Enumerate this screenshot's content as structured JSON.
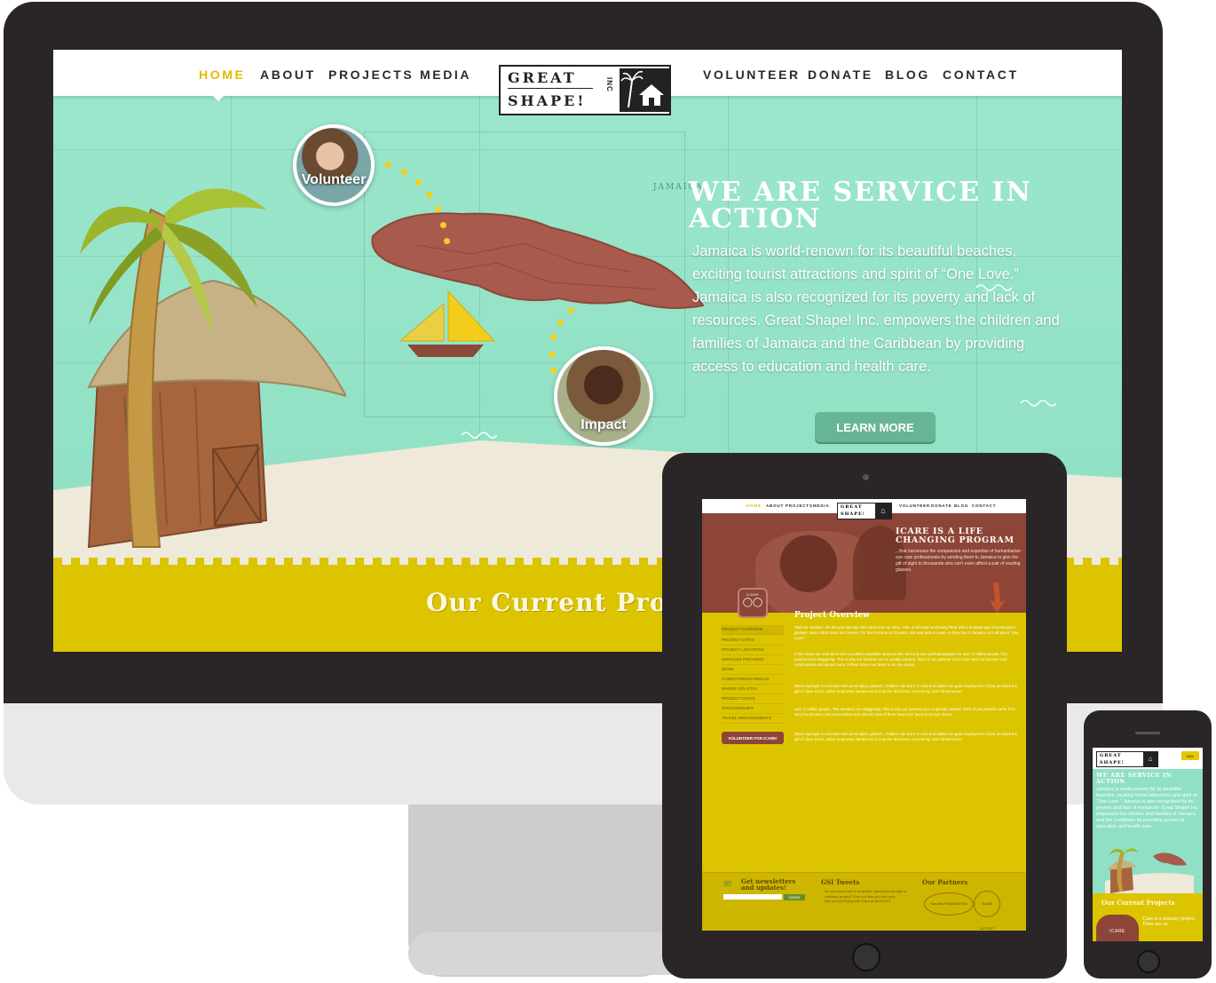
{
  "desktop": {
    "nav_left": [
      "HOME",
      "ABOUT",
      "PROJECTS",
      "MEDIA"
    ],
    "nav_right": [
      "VOLUNTEER",
      "DONATE",
      "BLOG",
      "CONTACT"
    ],
    "active_nav": "HOME",
    "logo_text_top": "GREAT",
    "logo_text_bottom": "SHAPE!",
    "logo_inc": "INC",
    "circle_volunteer": "Volunteer",
    "circle_impact": "Impact",
    "map_label": "JAMAICA",
    "hero_title": "WE ARE SERVICE IN ACTION",
    "hero_body": "Jamaica is world-renown for its beautiful beaches, exciting tourist attractions and spirit of “One Love.” Jamaica is also recognized for its poverty and lack of resources. Great Shape! Inc. empowers the children and families of Jamaica and the Caribbean by providing access to education and health care.",
    "learn_more": "LEARN MORE",
    "current_projects": "Our Current Pro"
  },
  "tablet": {
    "nav": [
      "HOME",
      "ABOUT",
      "PROJECTS",
      "MEDIA",
      "VOLUNTEER",
      "DONATE",
      "BLOG",
      "CONTACT"
    ],
    "hero_title": "ICARE IS A LIFE CHANGING PROGRAM",
    "hero_body": "...that harnesses the compassion and expertise of humanitarian eye care professionals by sending them to Jamaica to give the gift of sight to thousands who can't even afford a pair of reading glasses.",
    "badge": "ICARE",
    "overview_title": "Project Overview",
    "side_menu": [
      "PROJECT OVERVIEW",
      "PROJECT DATES",
      "PROJECT LOCATIONS",
      "SERVICES PROVIDED",
      "WORK",
      "CONDITIONS/SCHEDULE",
      "WHERE YOU STAY",
      "PROJECT COSTS",
      "SPONSORSHIPS",
      "TRAVEL ARRANGEMENTS"
    ],
    "volunteer_button": "VOLUNTEER FOR ICARE!",
    "paragraphs": [
      "Take Mr. Wallace, the 80 year old lady who came into our clinic. After a full exam and being fitted with a donated pair of prescription glasses, tears rolled down her cheeks. For the first time in 10 years, she was able to read. As they say in Jamaica, it is all about “One Love!”",
      "In the areas we work there are no publicly available optometrists, and only two ophthalmologists for over ½ million people. The numbers are staggering. This is why our services are so greatly needed. Most of our patients come from very low income rural communities and almost none of them have ever been to an eye doctor.",
      "When eyesight is corrected with prescription glasses, children can learn to read and adults can gain employment. iCare provides the gift of clear vision, which empowers Jamaicans to improve their lives, community, and infrastructure.",
      "over ½ million people. The numbers are staggering. This is why our services are so greatly needed. Most of our patients come from very low income rural communities and almost none of them have ever been to an eye doctor.",
      "When eyesight is corrected with prescription glasses, children can learn to read and adults can gain employment. iCare provides the gift of clear vision, which empowers Jamaicans to improve their lives, community, and infrastructure."
    ],
    "newsletter_title": "Get newsletters and updates!",
    "submit": "SUBMIT",
    "tweets_title": "GSI Tweets",
    "tweet_text": "Do you know how to empower Jamaicans through a visionary project? Find out how you can help: http://ow.ly/97Qpq with iCare project 2012",
    "partners_title": "Our Partners",
    "partner_1": "Sandals FOUNDATION",
    "partner_2": "ISLAND OUTPOST"
  },
  "phone": {
    "nav_button": "NAV",
    "hero_title": "WE ARE SERVICE IN ACTION",
    "hero_body": "Jamaica is world-renown for its beautiful beaches, exciting tourist attractions and spirit of “One Love.” Jamaica is also recognized for its poverty and lack of resources. Great Shape! Inc. empowers the children and families of Jamaica and the Caribbean by providing access to education and health care.",
    "current_projects": "Our Current Projects",
    "badge": "ICARE",
    "project_text": "iCare is a visionary project. There are no"
  },
  "colors": {
    "accent_yellow": "#dcc400",
    "sea_green": "#8fe0c4",
    "map_brown": "#a85a4c",
    "device_dark": "#2a2627",
    "button_green": "#67b597"
  }
}
